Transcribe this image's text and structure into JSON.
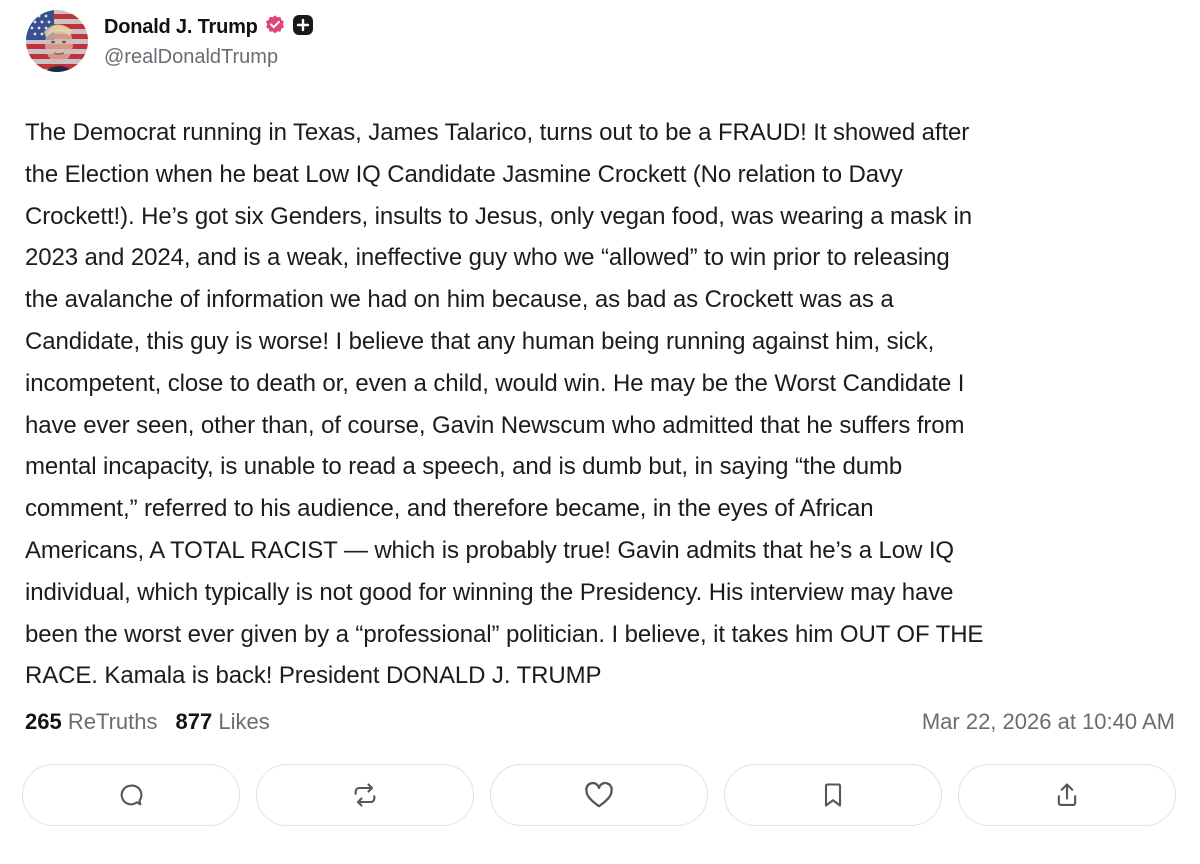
{
  "author": {
    "display_name": "Donald J. Trump",
    "handle": "@realDonaldTrump",
    "verified_badge": "verified-badge-icon",
    "plus_badge": "plus-badge-icon",
    "colors": {
      "verified": "#e0457b",
      "plus": "#1a1a1a"
    }
  },
  "post": {
    "lines": [
      "The Democrat running in Texas, James Talarico, turns out to be a FRAUD! It showed after",
      "the Election when he beat Low IQ Candidate Jasmine Crockett (No relation to Davy",
      "Crockett!). He’s got six Genders, insults to Jesus, only vegan food, was wearing a mask in",
      "2023 and 2024, and is a weak, ineffective guy who we “allowed” to win prior to releasing",
      "the avalanche of information we had on him because, as bad as Crockett was as a",
      "Candidate, this guy is worse! I believe that any human being running against him, sick,",
      "incompetent, close to death or, even a child, would win. He may be the Worst Candidate I",
      "have ever seen, other than, of course, Gavin Newscum who admitted that he suffers from",
      "mental incapacity, is unable to read a speech, and is dumb but, in saying “the dumb",
      "comment,” referred to his audience, and therefore became, in the eyes of African",
      "Americans, A TOTAL RACIST — which is probably true! Gavin admits that he’s a Low IQ",
      "individual, which typically is not good for winning the Presidency. His interview may have",
      "been the worst ever given by a “professional” politician. I believe, it takes him OUT OF THE",
      "RACE. Kamala is back! President DONALD J. TRUMP"
    ]
  },
  "stats": {
    "retruths_count": "265",
    "retruths_label": "ReTruths",
    "likes_count": "877",
    "likes_label": "Likes"
  },
  "timestamp": "Mar 22, 2026 at 10:40 AM",
  "actions": [
    {
      "name": "reply",
      "icon": "reply-icon"
    },
    {
      "name": "retruth",
      "icon": "retruth-icon"
    },
    {
      "name": "like",
      "icon": "heart-icon"
    },
    {
      "name": "bookmark",
      "icon": "bookmark-icon"
    },
    {
      "name": "share",
      "icon": "share-icon"
    }
  ]
}
